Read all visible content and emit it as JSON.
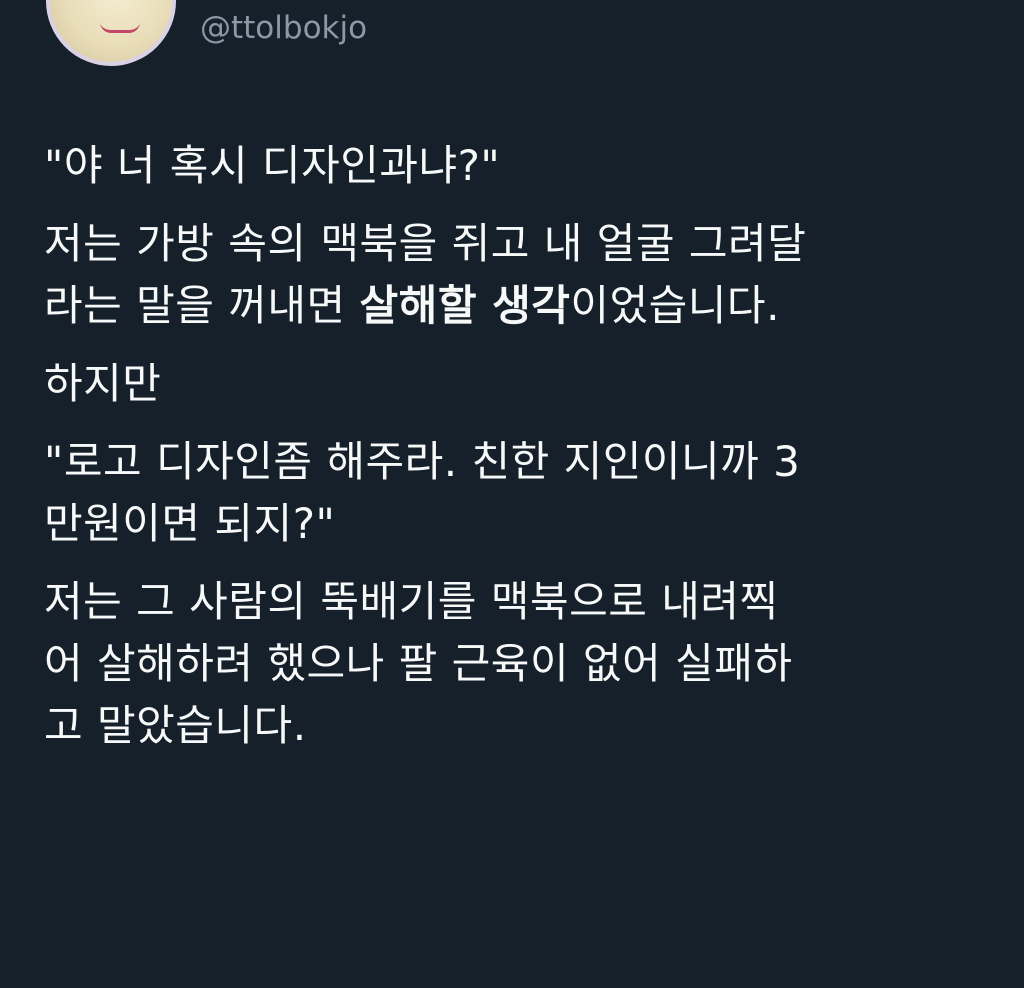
{
  "author": {
    "handle": "@ttolbokjo"
  },
  "tweet": {
    "p1": "\"야 너 혹시 디자인과냐?\"",
    "p2": {
      "line1": "저는 가방 속의 맥북을 쥐고 내 얼굴 그려달",
      "line2_prefix": "라는 말을 꺼내면 ",
      "line2_bold": "살해할 생각",
      "line2_suffix": "이었습니다."
    },
    "p3": "하지만",
    "p4": {
      "line1": "\"로고 디자인좀 해주라. 친한 지인이니까 3",
      "line2": "만원이면 되지?\""
    },
    "p5": {
      "line1": "저는 그 사람의 뚝배기를 맥북으로 내려찍",
      "line2": "어 살해하려 했으나 팔 근육이 없어 실패하",
      "line3": "고 말았습니다."
    }
  },
  "colors": {
    "background": "#15202b",
    "text": "#f7f9f9",
    "handle": "#8b98a5"
  }
}
